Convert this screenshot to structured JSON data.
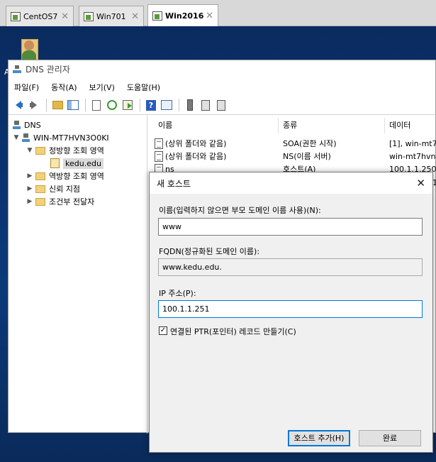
{
  "host_tabs": [
    {
      "label": "CentOS7",
      "active": false
    },
    {
      "label": "Win701",
      "active": false
    },
    {
      "label": "Win2016",
      "active": true
    }
  ],
  "desktop": {
    "edge_letter": "A"
  },
  "window": {
    "title": "DNS 관리자"
  },
  "menu": [
    "파일(F)",
    "동작(A)",
    "보기(V)",
    "도움말(H)"
  ],
  "toolbar": {
    "help_glyph": "?"
  },
  "tree": {
    "root": "DNS",
    "server": "WIN-MT7HVN3O0KI",
    "forward_zone": "정방향 조회 영역",
    "zone": "kedu.edu",
    "reverse_zone": "역방향 조회 영역",
    "trust_points": "신뢰 지점",
    "conditional_forwarders": "조건부 전달자"
  },
  "list": {
    "columns": [
      "이름",
      "종류",
      "데이터"
    ],
    "rows": [
      {
        "name": "(상위 폴더와 같음)",
        "type": "SOA(권한 시작)",
        "data": "[1], win-mt7"
      },
      {
        "name": "(상위 폴더와 같음)",
        "type": "NS(이름 서버)",
        "data": "win-mt7hvn"
      },
      {
        "name": "ns",
        "type": "호스트(A)",
        "data": "100.1.1.250"
      }
    ],
    "row4_data_partial": "1"
  },
  "dialog": {
    "title": "새 호스트",
    "close_glyph": "✕",
    "name_label": "이름(입력하지 않으면 부모 도메인 이름 사용)(N):",
    "name_value": "www",
    "fqdn_label": "FQDN(정규화된 도메인 이름):",
    "fqdn_value": "www.kedu.edu.",
    "ip_label": "IP 주소(P):",
    "ip_value": "100.1.1.251",
    "ptr_label": "연결된 PTR(포인터) 레코드 만들기(C)",
    "ptr_checked": true,
    "add_host_button": "호스트 추가(H)",
    "done_button": "완료"
  }
}
